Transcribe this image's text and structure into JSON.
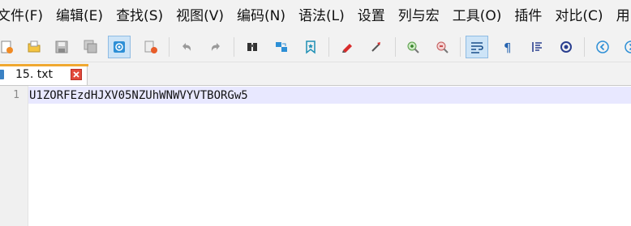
{
  "menubar": {
    "items": [
      {
        "label": "文件(F)"
      },
      {
        "label": "编辑(E)"
      },
      {
        "label": "查找(S)"
      },
      {
        "label": "视图(V)"
      },
      {
        "label": "编码(N)"
      },
      {
        "label": "语法(L)"
      },
      {
        "label": "设置"
      },
      {
        "label": "列与宏"
      },
      {
        "label": "工具(O)"
      },
      {
        "label": "插件"
      },
      {
        "label": "对比(C)"
      },
      {
        "label": "用"
      }
    ]
  },
  "toolbar": {
    "buttons": [
      {
        "icon": "new-file-icon",
        "active": false
      },
      {
        "icon": "open-file-icon",
        "active": false
      },
      {
        "icon": "save-icon",
        "active": false
      },
      {
        "icon": "save-all-icon",
        "active": false
      },
      {
        "icon": "web-icon",
        "active": true
      },
      {
        "icon": "close-file-icon",
        "active": false
      },
      {
        "icon": "undo-icon",
        "active": false
      },
      {
        "icon": "redo-icon",
        "active": false
      },
      {
        "icon": "find-icon",
        "active": false
      },
      {
        "icon": "replace-icon",
        "active": false
      },
      {
        "icon": "bookmark-icon",
        "active": false
      },
      {
        "icon": "record-macro-icon",
        "active": false
      },
      {
        "icon": "play-macro-icon",
        "active": false
      },
      {
        "icon": "zoom-in-icon",
        "active": false
      },
      {
        "icon": "zoom-out-icon",
        "active": false
      },
      {
        "icon": "word-wrap-icon",
        "active": true
      },
      {
        "icon": "show-all-characters-icon",
        "active": false
      },
      {
        "icon": "indent-guide-icon",
        "active": false
      },
      {
        "icon": "settings-icon",
        "active": false
      },
      {
        "icon": "previous-icon",
        "active": false
      },
      {
        "icon": "next-icon",
        "active": false
      }
    ]
  },
  "tabs": [
    {
      "label": "15. txt",
      "active": true,
      "accent_color": "#f0a830"
    }
  ],
  "editor": {
    "lines": [
      {
        "number": "1",
        "text": "U1ZORFEzdHJXV05NZUhWNWVYVTBORGw5"
      }
    ],
    "current_line_color": "#e8e8ff"
  }
}
